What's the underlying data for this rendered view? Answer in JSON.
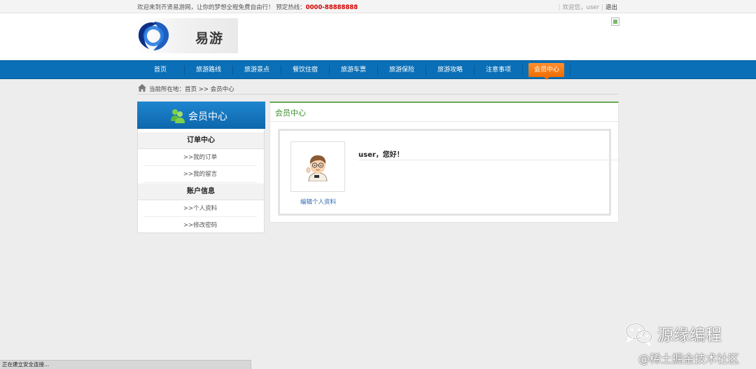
{
  "topbar": {
    "welcome": "欢迎来到齐贤易游网，让你的梦想全程免费自由行！ 预定热线：",
    "hotline": "0000-88888888",
    "greeting": "欢迎您，user",
    "logout": "退出"
  },
  "header": {
    "logo_text": "易游"
  },
  "nav": {
    "items": [
      {
        "label": "首页"
      },
      {
        "label": "旅游路线"
      },
      {
        "label": "旅游景点"
      },
      {
        "label": "餐饮住宿"
      },
      {
        "label": "旅游车票"
      },
      {
        "label": "旅游保险"
      },
      {
        "label": "旅游攻略"
      },
      {
        "label": "注意事项"
      },
      {
        "label": "会员中心",
        "active": true
      }
    ]
  },
  "breadcrumb": {
    "text": "当前所在地：首页 >> 会员中心"
  },
  "sidebar": {
    "title": "会员中心",
    "group1": "订单中心",
    "links1": [
      ">>我的订单",
      ">>我的留言"
    ],
    "group2": "账户信息",
    "links2": [
      ">>个人资料",
      ">>修改密码"
    ]
  },
  "main": {
    "title": "会员中心",
    "edit_profile": "编辑个人资料",
    "greeting": "user，您好！"
  },
  "statusbar": {
    "text": "正在建立安全连接..."
  },
  "watermark": {
    "line1": "源缘编程",
    "line2": "@稀土掘金技术社区"
  }
}
